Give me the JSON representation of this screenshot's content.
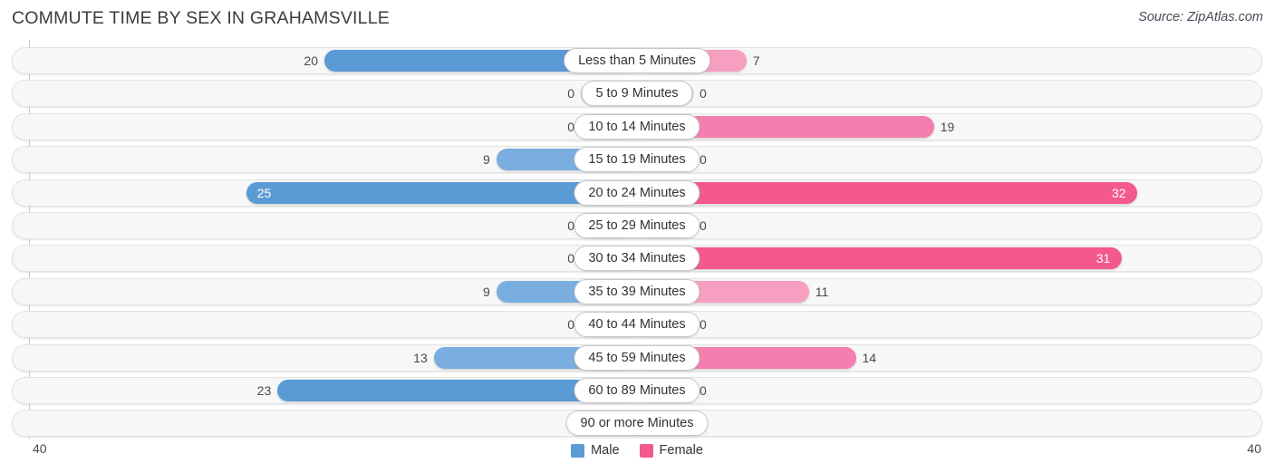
{
  "header": {
    "title": "COMMUTE TIME BY SEX IN GRAHAMSVILLE",
    "source": "Source: ZipAtlas.com"
  },
  "axis": {
    "left_tick": "40",
    "right_tick": "40",
    "max": 40
  },
  "legend": {
    "items": [
      {
        "label": "Male",
        "color": "#5b9bd5"
      },
      {
        "label": "Female",
        "color": "#f4598c"
      }
    ]
  },
  "colors": {
    "male_strong": "#5b9bd5",
    "male_mid": "#7aaee0",
    "male_light": "#aecbec",
    "female_strong": "#f4598c",
    "female_mid": "#f47fae",
    "female_light": "#f79fc0",
    "track_bg": "#f7f7f7",
    "track_border": "#e3e3e3"
  },
  "chart_data": {
    "type": "bar",
    "orientation": "horizontal-diverging",
    "title": "COMMUTE TIME BY SEX IN GRAHAMSVILLE",
    "xlabel": "",
    "ylabel": "",
    "xlim": [
      -40,
      40
    ],
    "grid": false,
    "legend_position": "bottom-center",
    "categories": [
      "Less than 5 Minutes",
      "5 to 9 Minutes",
      "10 to 14 Minutes",
      "15 to 19 Minutes",
      "20 to 24 Minutes",
      "25 to 29 Minutes",
      "30 to 34 Minutes",
      "35 to 39 Minutes",
      "40 to 44 Minutes",
      "45 to 59 Minutes",
      "60 to 89 Minutes",
      "90 or more Minutes"
    ],
    "series": [
      {
        "name": "Male",
        "side": "left",
        "values": [
          20,
          0,
          0,
          9,
          25,
          0,
          0,
          9,
          0,
          13,
          23,
          0
        ]
      },
      {
        "name": "Female",
        "side": "right",
        "values": [
          7,
          0,
          19,
          0,
          32,
          0,
          31,
          11,
          0,
          14,
          0,
          0
        ]
      }
    ]
  },
  "rows": [
    {
      "category": "Less than 5 Minutes",
      "male": "20",
      "female": "7",
      "male_value": 20,
      "female_value": 7,
      "male_inside": false,
      "female_inside": false
    },
    {
      "category": "5 to 9 Minutes",
      "male": "0",
      "female": "0",
      "male_value": 0,
      "female_value": 0,
      "male_inside": false,
      "female_inside": false
    },
    {
      "category": "10 to 14 Minutes",
      "male": "0",
      "female": "19",
      "male_value": 0,
      "female_value": 19,
      "male_inside": false,
      "female_inside": false
    },
    {
      "category": "15 to 19 Minutes",
      "male": "9",
      "female": "0",
      "male_value": 9,
      "female_value": 0,
      "male_inside": false,
      "female_inside": false
    },
    {
      "category": "20 to 24 Minutes",
      "male": "25",
      "female": "32",
      "male_value": 25,
      "female_value": 32,
      "male_inside": true,
      "female_inside": true
    },
    {
      "category": "25 to 29 Minutes",
      "male": "0",
      "female": "0",
      "male_value": 0,
      "female_value": 0,
      "male_inside": false,
      "female_inside": false
    },
    {
      "category": "30 to 34 Minutes",
      "male": "0",
      "female": "31",
      "male_value": 0,
      "female_value": 31,
      "male_inside": false,
      "female_inside": true
    },
    {
      "category": "35 to 39 Minutes",
      "male": "9",
      "female": "11",
      "male_value": 9,
      "female_value": 11,
      "male_inside": false,
      "female_inside": false
    },
    {
      "category": "40 to 44 Minutes",
      "male": "0",
      "female": "0",
      "male_value": 0,
      "female_value": 0,
      "male_inside": false,
      "female_inside": false
    },
    {
      "category": "45 to 59 Minutes",
      "male": "13",
      "female": "14",
      "male_value": 13,
      "female_value": 14,
      "male_inside": false,
      "female_inside": false
    },
    {
      "category": "60 to 89 Minutes",
      "male": "23",
      "female": "0",
      "male_value": 23,
      "female_value": 0,
      "male_inside": false,
      "female_inside": false
    },
    {
      "category": "90 or more Minutes",
      "male": "0",
      "female": "0",
      "male_value": 0,
      "female_value": 0,
      "male_inside": false,
      "female_inside": false
    }
  ]
}
